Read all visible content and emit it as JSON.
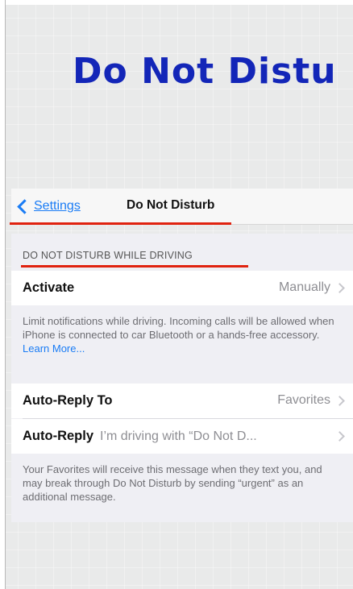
{
  "slide": {
    "title": "Do Not Distu"
  },
  "navbar": {
    "back_label": "Settings",
    "title": "Do Not Disturb"
  },
  "section": {
    "header": "DO NOT DISTURB WHILE DRIVING",
    "activate": {
      "label": "Activate",
      "value": "Manually"
    },
    "activate_footer": "Limit notifications while driving. Incoming calls will be allowed when iPhone is connected to car Bluetooth or a hands-free accessory.",
    "learn_more": "Learn More...",
    "auto_reply_to": {
      "label": "Auto-Reply To",
      "value": "Favorites"
    },
    "auto_reply": {
      "label": "Auto-Reply",
      "value": "I’m driving with “Do Not D..."
    },
    "auto_reply_footer": "Your Favorites will receive this message when they text you, and may break through Do Not Disturb by sending “urgent” as an additional message."
  },
  "colors": {
    "title_blue": "#1326b8",
    "ios_blue": "#1a7cf5",
    "annotation_red": "#e0220f",
    "group_background": "#efeff4"
  }
}
